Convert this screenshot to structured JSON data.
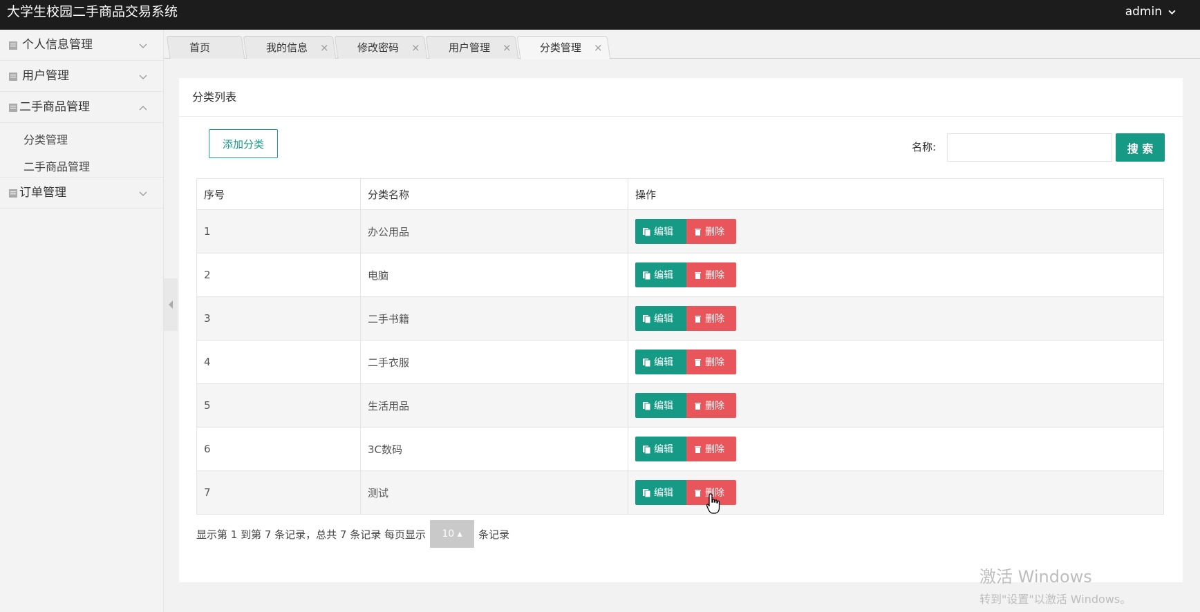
{
  "app": {
    "title": "大学生校园二手商品交易系统",
    "user": "admin"
  },
  "sidebar": {
    "groups": [
      {
        "label": "个人信息管理"
      },
      {
        "label": "用户管理"
      },
      {
        "label": "二手商品管理",
        "items": [
          "分类管理",
          "二手商品管理"
        ]
      },
      {
        "label": "订单管理"
      }
    ]
  },
  "tabs": [
    {
      "label": "首页"
    },
    {
      "label": "我的信息",
      "close": "×"
    },
    {
      "label": "修改密码",
      "close": "×"
    },
    {
      "label": "用户管理",
      "close": "×"
    },
    {
      "label": "分类管理",
      "close": "×"
    }
  ],
  "panel": {
    "title": "分类列表",
    "add_button": "添加分类",
    "search": {
      "label": "名称:",
      "value": "",
      "button": "搜 索"
    }
  },
  "table": {
    "headers": [
      "序号",
      "分类名称",
      "操作"
    ],
    "rows": [
      {
        "idx": "1",
        "name": "办公用品"
      },
      {
        "idx": "2",
        "name": "电脑"
      },
      {
        "idx": "3",
        "name": "二手书籍"
      },
      {
        "idx": "4",
        "name": "二手衣服"
      },
      {
        "idx": "5",
        "name": "生活用品"
      },
      {
        "idx": "6",
        "name": "3C数码"
      },
      {
        "idx": "7",
        "name": "测试"
      }
    ],
    "edit_label": "编辑",
    "delete_label": "删除"
  },
  "pagination": {
    "summary": "显示第 1 到第 7 条记录，总共 7 条记录 每页显示",
    "page_size": "10 ▴",
    "suffix": "条记录"
  },
  "watermark": {
    "title": "激活 Windows",
    "subtitle": "转到\"设置\"以激活 Windows。"
  },
  "colors": {
    "primary": "#169a86",
    "danger": "#e8555a",
    "topbar": "#1c1c1c"
  }
}
